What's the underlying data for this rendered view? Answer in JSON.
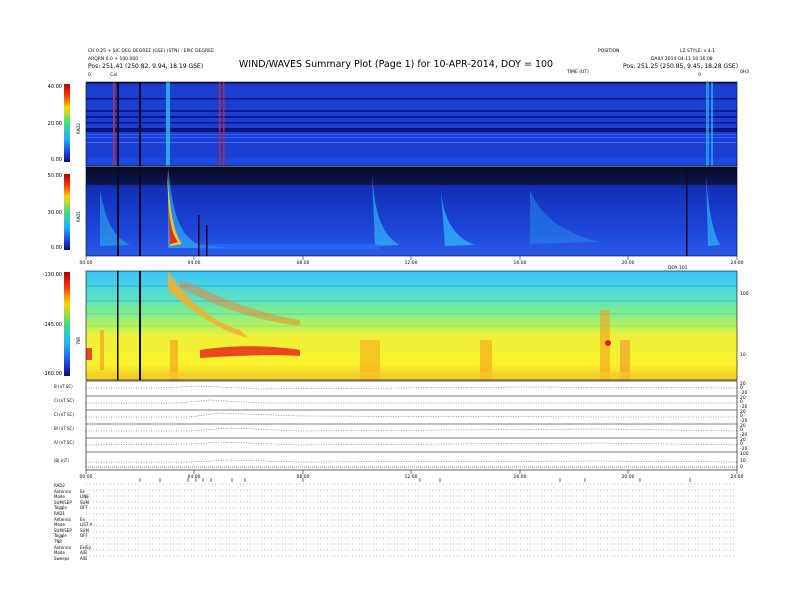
{
  "header": {
    "title": "WIND/WAVES Summary Plot (Page 1) for 10-APR-2014, DOY = 100",
    "top_left_1": "CH 0.25 + SIC DEG DEGREE (GSE) (STN) - EPIC DEGREE",
    "top_left_2": "ARQRN 0.0 + 100.000",
    "top_left_orbit": "Pos: 251.41 (250.82, 9.94, 18.19 GSE)",
    "top_right_1": "POSITION",
    "top_right_2": "DAILY 2014-04-11 10:16:08",
    "top_right_3": "LZ STYLE: v 4.1",
    "top_right_orbit": "Pos: 251.25 (250.85, 9.45, 18.28 GSE)",
    "time_label": "TIME (UT)",
    "rad1_marker": "Cal",
    "n_marker_left": "0",
    "n_marker_right": "0",
    "end_label": "0H3"
  },
  "colors": {
    "bg_blue": "#1b3fd0",
    "dark_blue": "#0a1a8a",
    "cyan": "#35c8ff",
    "green": "#4bdc8a",
    "yellow": "#f2f228",
    "orange": "#f59a1a",
    "red": "#e21e1e"
  },
  "chart_data": [
    {
      "type": "heatmap",
      "panel": "RAD2",
      "ylabel": "RAD2",
      "colorbar_ticks": [
        "40.00",
        "20.00",
        "0.00"
      ],
      "xlim": [
        0,
        24
      ],
      "x_unit": "hours UT"
    },
    {
      "type": "heatmap",
      "panel": "RAD1",
      "ylabel": "RAD1",
      "colorbar_ticks": [
        "50.00",
        "30.00",
        "0.00"
      ],
      "xlim": [
        0,
        24
      ],
      "x_tick_labels": [
        "00:00",
        "04:00",
        "08:00",
        "12:00",
        "16:00",
        "20:00",
        "24:00"
      ],
      "end_label": "DOY 101"
    },
    {
      "type": "heatmap",
      "panel": "TNR",
      "ylabel": "TNR",
      "colorbar_ticks": [
        "-130.00",
        "-145.00",
        "-160.00"
      ],
      "right_axis_ticks": [
        "100",
        "10"
      ],
      "xlim": [
        0,
        24
      ]
    },
    {
      "type": "line",
      "panel": "ancillary",
      "row_labels": [
        "B (nT SC)",
        "Cl (nT SC)",
        "Cl (nT SC)",
        "Bl (nT SC)",
        "Al (nT SC)",
        "|B| (nT)"
      ],
      "right_ticks": [
        [
          "20",
          "0",
          "-20"
        ],
        [
          "20",
          "0",
          "-20"
        ],
        [
          "20",
          "0",
          "-20"
        ],
        [
          "20",
          "0",
          "-20"
        ],
        [
          "20",
          "0",
          "-20"
        ],
        [
          "100",
          "10",
          "0"
        ]
      ],
      "x_tick_labels": [
        "00:00",
        "04:00",
        "08:00",
        "12:00",
        "16:00",
        "20:00",
        "24:00"
      ],
      "xlim": [
        0,
        24
      ]
    }
  ],
  "mode_list": [
    {
      "k": "RAD2",
      "v": ""
    },
    {
      "k": "Antenna",
      "v": "Ex"
    },
    {
      "k": "Mode",
      "v": "LINE"
    },
    {
      "k": "SUM/SEP",
      "v": "SUM"
    },
    {
      "k": "Toggle",
      "v": "OFF"
    },
    {
      "k": "RAD1",
      "v": ""
    },
    {
      "k": "Antenna",
      "v": "Ex"
    },
    {
      "k": "Mode",
      "v": "LIST A"
    },
    {
      "k": "SUM/SEP",
      "v": "SUM"
    },
    {
      "k": "Toggle",
      "v": "OFF"
    },
    {
      "k": "TNR",
      "v": ""
    },
    {
      "k": "Antenna",
      "v": "Ex/Ey"
    },
    {
      "k": "Mode",
      "v": "A/B"
    },
    {
      "k": "Sweeps",
      "v": "A/B"
    }
  ]
}
